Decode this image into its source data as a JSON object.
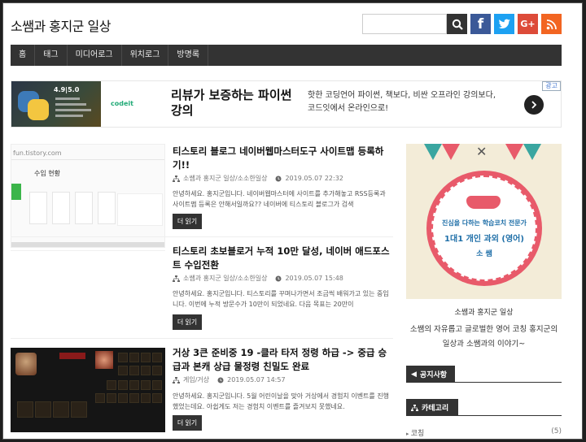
{
  "header": {
    "site_title": "소쌤과 홍지군 일상",
    "search_placeholder": "",
    "social": {
      "facebook": "f",
      "twitter": "t",
      "googleplus": "G+",
      "rss": "rss"
    }
  },
  "nav": {
    "items": [
      "홈",
      "태그",
      "미디어로그",
      "위치로그",
      "방명록"
    ]
  },
  "ad": {
    "rating": "4.9|5.0",
    "brand": "codeit",
    "headline": "리뷰가 보증하는 파이썬 강의",
    "description": "핫한 코딩언어 파이썬, 책보다, 비싼 오프라인 강의보다, 코드잇에서 온라인으로!",
    "tag": "광고"
  },
  "posts": [
    {
      "title": "티스토리 블로그 네이버웹마스터도구 사이트맵 등록하기!!",
      "category": "소쌤과 홍지군 일상/소소한일상",
      "date": "2019.05.07 22:32",
      "excerpt": "안녕하세요. 홍지군입니다. 네이버웹마스터에 사이트를 추가해놓고 RSS등록과 사이트맵 등록은 안해서일까요?? 네이버에 티스토리 블로그가 검색",
      "thumb_url": "fun.tistory.com",
      "thumb_label": "수입 현황",
      "more": "더 읽기"
    },
    {
      "title": "티스토리 초보블로거 누적 10만 달성, 네이버 애드포스트 수입전환",
      "category": "소쌤과 홍지군 일상/소소한일상",
      "date": "2019.05.07 15:48",
      "excerpt": "안녕하세요. 홍지군입니다. 티스토리를 꾸며나가면서 조금씩 배워가고 있는 중입니다. 이번에 누적 방문수가 10만이 되었네요. 다음 목표는 20만이",
      "more": "더 읽기"
    },
    {
      "title": "거상 3큰 준비중 19 -클라 타저 정령 하급 -> 중급 승급과 본캐 상급 물정령 친밀도 완료",
      "category": "게임/거상",
      "date": "2019.05.07 14:57",
      "excerpt": "안녕하세요. 홍지군입니다. 5월 어린이날을 맞아 거상에서 경험치 이벤트를 진행했었는데요. 아쉽게도 저는 경험치 이벤트를 즐겨보지 못했네요.",
      "more": "더 읽기"
    }
  ],
  "sidebar": {
    "banner": {
      "line1": "진심을 다하는 학습코치 전문가",
      "line2": "1대1 개인 과외 (영어)",
      "line3": "소 쌤"
    },
    "profile_name": "소쌤과 홍지군 일상",
    "profile_desc": "소쌤의 자유롭고 글로벌한 영어 코칭 홍지군의 일상과 소쌤과의 이야기~",
    "notice_title": "공지사항",
    "category_title": "카테고리",
    "categories": [
      {
        "name": "코칭",
        "count": "(5)"
      }
    ]
  },
  "colors": {
    "nav_bg": "#333333",
    "facebook": "#3b5998",
    "twitter": "#1da1f2",
    "googleplus": "#dd4b39",
    "rss": "#f26522",
    "banner_accent": "#e85a6a"
  }
}
